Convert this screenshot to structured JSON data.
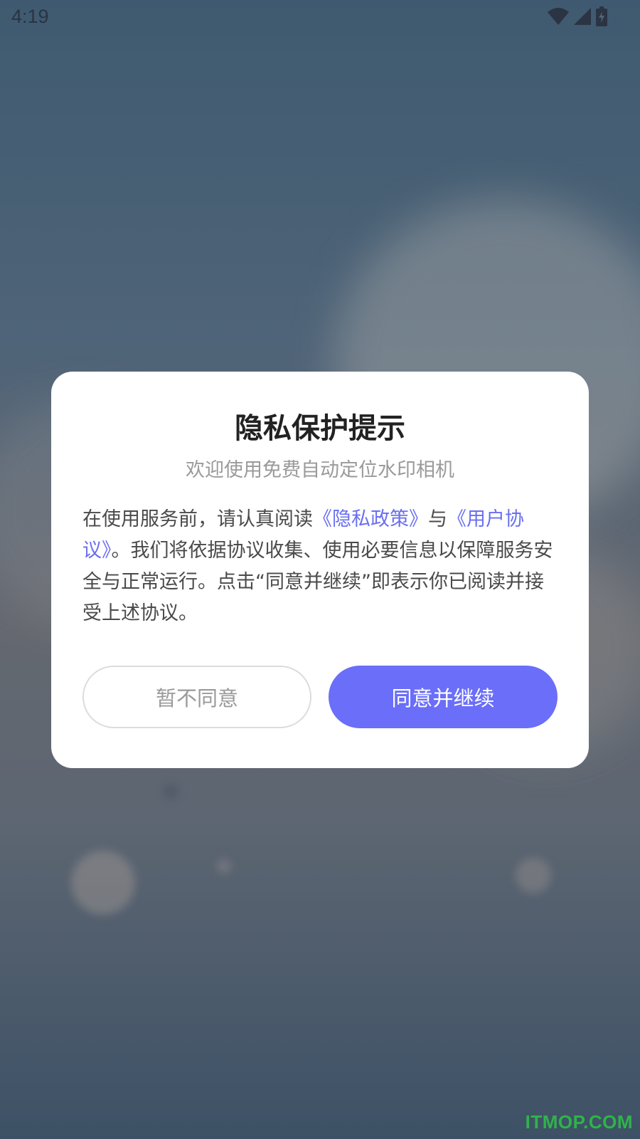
{
  "status_bar": {
    "time": "4:19",
    "icons": [
      "wifi-icon",
      "cellular-signal-icon",
      "battery-charging-icon"
    ]
  },
  "dialog": {
    "title": "隐私保护提示",
    "subtitle": "欢迎使用免费自动定位水印相机",
    "body": {
      "text_before": "在使用服务前，请认真阅读",
      "privacy_link": "《隐私政策》",
      "text_between": "与",
      "agreement_link": "《用户协议》",
      "text_after": "。我们将依据协议收集、使用必要信息以保障服务安全与正常运行。点击“同意并继续”即表示你已阅读并接受上述协议。"
    },
    "decline_button": "暂不同意",
    "agree_button": "同意并继续"
  },
  "watermark": "ITMOP.COM",
  "colors": {
    "accent": "#6a6ef8",
    "link": "#6a6ff2",
    "watermark": "#2fb34a"
  }
}
